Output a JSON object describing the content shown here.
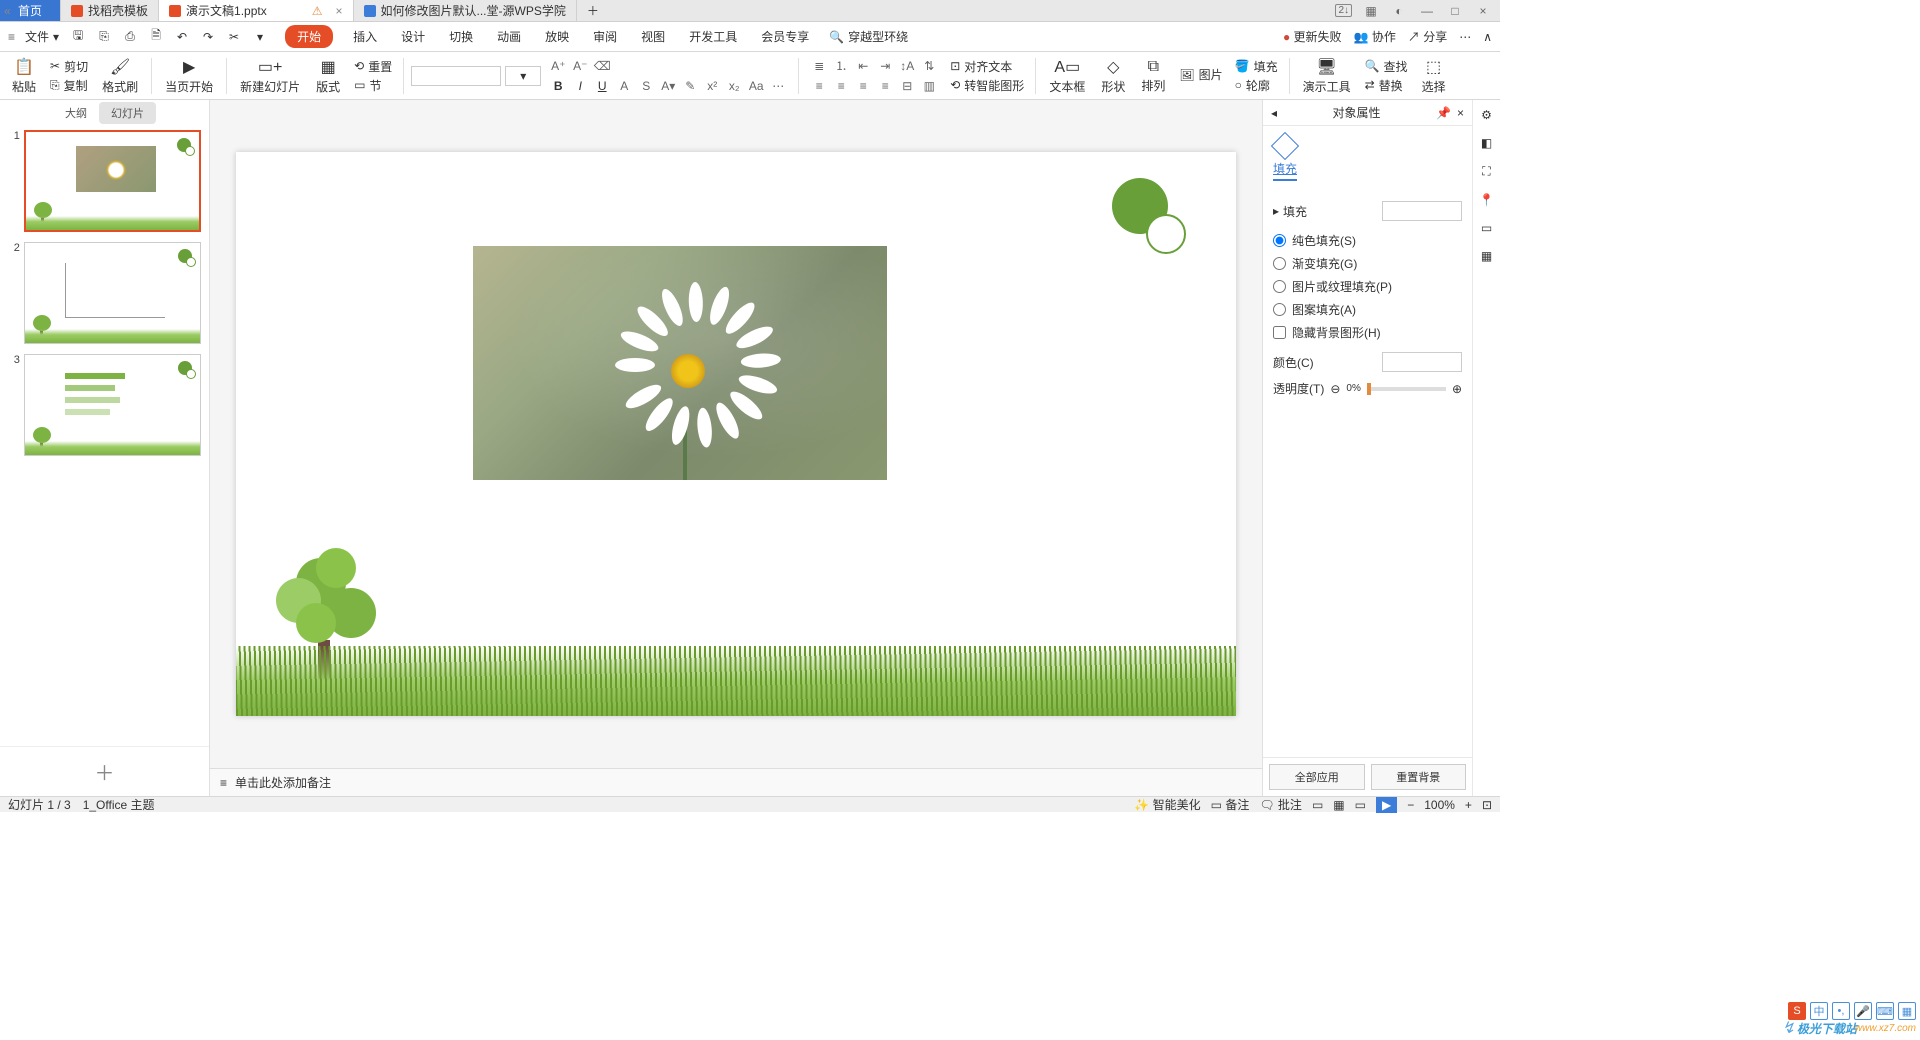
{
  "titlebar": {
    "home": "首页",
    "tab_template": "找稻壳模板",
    "tab_doc": "演示文稿1.pptx",
    "tab_help": "如何修改图片默认...堂-源WPS学院"
  },
  "winctrl": {
    "badge": "2↓"
  },
  "menubar": {
    "file": "文件",
    "tabs": {
      "start": "开始",
      "insert": "插入",
      "design": "设计",
      "transition": "切换",
      "animation": "动画",
      "slideshow": "放映",
      "review": "审阅",
      "view": "视图",
      "dev": "开发工具",
      "member": "会员专享"
    },
    "search_placeholder": "穿越型环绕",
    "right": {
      "update_fail": "更新失败",
      "collab": "协作",
      "share": "分享"
    }
  },
  "ribbon": {
    "paste": "粘贴",
    "cut": "剪切",
    "copy": "复制",
    "format_painter": "格式刷",
    "from_current": "当页开始",
    "new_slide": "新建幻灯片",
    "layout": "版式",
    "section": "节",
    "reset": "重置",
    "align_text": "对齐文本",
    "convert_shape": "转智能图形",
    "textbox": "文本框",
    "shape": "形状",
    "arrange": "排列",
    "picture": "图片",
    "fill": "填充",
    "outline": "轮廓",
    "presentation_tools": "演示工具",
    "find": "查找",
    "replace": "替换",
    "select": "选择"
  },
  "left": {
    "outline": "大纲",
    "slides": "幻灯片"
  },
  "notes_placeholder": "单击此处添加备注",
  "props": {
    "title": "对象属性",
    "tab_fill": "填充",
    "fill_header": "填充",
    "solid": "纯色填充(S)",
    "gradient": "渐变填充(G)",
    "picture": "图片或纹理填充(P)",
    "pattern": "图案填充(A)",
    "hide_bg": "隐藏背景图形(H)",
    "color_label": "颜色(C)",
    "opacity_label": "透明度(T)",
    "opacity_value": "0%",
    "apply_all": "全部应用",
    "reset_bg": "重置背景"
  },
  "status": {
    "slide_info": "幻灯片 1 / 3",
    "theme": "1_Office 主题",
    "beautify": "智能美化",
    "notes": "备注",
    "comments": "批注",
    "zoom": "100%"
  },
  "watermark": {
    "brand": "极光下载站",
    "url": "www.xz7.com"
  }
}
